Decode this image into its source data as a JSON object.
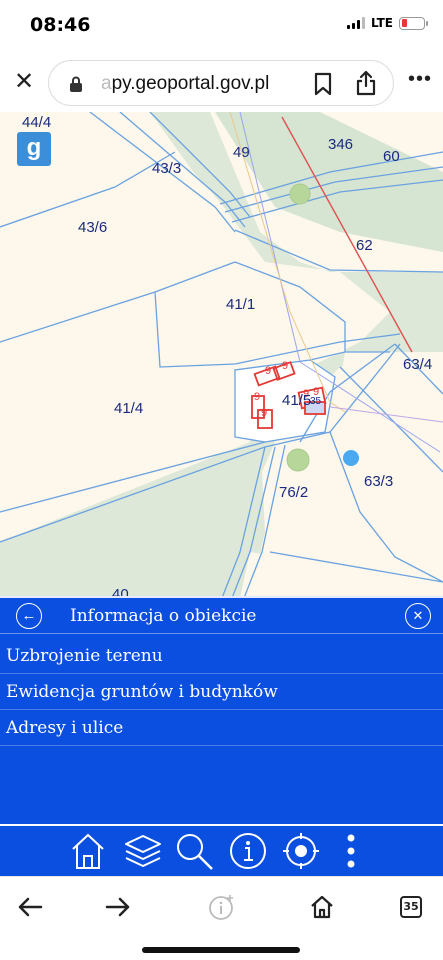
{
  "status": {
    "time": "08:46",
    "network": "LTE",
    "battery_color": "#e53935"
  },
  "browser": {
    "url_faded": "a",
    "url_main": "py.geoportal.gov.pl",
    "tabs_count": "35"
  },
  "map": {
    "parcels": [
      "44/4",
      "43/3",
      "49",
      "346",
      "60",
      "43/6",
      "62",
      "41/1",
      "63/4",
      "41/4",
      "41/5",
      "63/3",
      "76/2",
      "40"
    ],
    "building_markers": [
      "9",
      "9",
      "9",
      "9",
      "9",
      "9",
      "35"
    ],
    "colors": {
      "parcel_line": "#6aa2e0",
      "land": "#fdf7ec",
      "forest": "#dbe7d6",
      "building": "#e53935",
      "power_line": "#e05050"
    }
  },
  "info_panel": {
    "title": "Informacja o obiekcie",
    "items": [
      "Uzbrojenie terenu",
      "Ewidencja gruntów i budynków",
      "Adresy i ulice"
    ]
  },
  "toolbar": {
    "icons": [
      "home-icon",
      "layers-icon",
      "search-icon",
      "info-icon",
      "locate-icon",
      "more-vertical-icon"
    ]
  },
  "colors": {
    "panel_blue": "#0a4fe0"
  }
}
